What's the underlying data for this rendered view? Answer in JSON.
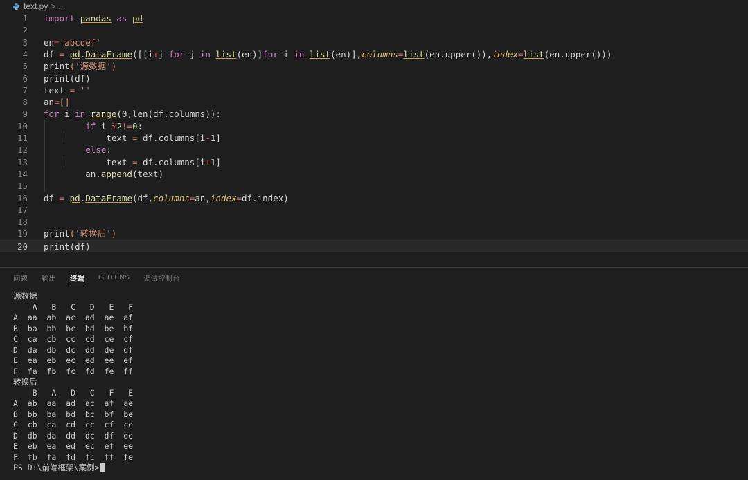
{
  "breadcrumb": {
    "file": "text.py",
    "separator": ">",
    "rest": "..."
  },
  "code_lines": [
    {
      "n": "1",
      "parts": [
        [
          "import",
          "kw"
        ],
        [
          " ",
          ""
        ],
        [
          "pandas",
          "mod"
        ],
        [
          " ",
          ""
        ],
        [
          "as",
          "kw"
        ],
        [
          " ",
          ""
        ],
        [
          "pd",
          "mod"
        ]
      ]
    },
    {
      "n": "2",
      "parts": []
    },
    {
      "n": "3",
      "parts": [
        [
          "en",
          "plain"
        ],
        [
          "=",
          "op"
        ],
        [
          "'abcdef'",
          "str"
        ]
      ]
    },
    {
      "n": "4",
      "parts": [
        [
          "df",
          "plain"
        ],
        [
          " = ",
          "op"
        ],
        [
          "pd",
          "mod"
        ],
        [
          ".",
          "plain"
        ],
        [
          "DataFrame",
          "mod"
        ],
        [
          "([[",
          "plain"
        ],
        [
          "i",
          "plain"
        ],
        [
          "+",
          "op"
        ],
        [
          "j ",
          "plain"
        ],
        [
          "for",
          "kw"
        ],
        [
          " j ",
          "plain"
        ],
        [
          "in",
          "kw"
        ],
        [
          " ",
          ""
        ],
        [
          "list",
          "mod"
        ],
        [
          "(en)]",
          "plain"
        ],
        [
          "for",
          "kw"
        ],
        [
          " i ",
          "plain"
        ],
        [
          "in",
          "kw"
        ],
        [
          " ",
          ""
        ],
        [
          "list",
          "mod"
        ],
        [
          "(en)],",
          "plain"
        ],
        [
          "columns",
          "param"
        ],
        [
          "=",
          "op"
        ],
        [
          "list",
          "mod"
        ],
        [
          "(en.upper()),",
          "plain"
        ],
        [
          "index",
          "param"
        ],
        [
          "=",
          "op"
        ],
        [
          "list",
          "mod"
        ],
        [
          "(en.upper()))",
          "plain"
        ]
      ]
    },
    {
      "n": "5",
      "parts": [
        [
          "print",
          "plain"
        ],
        [
          "('源数据')",
          "str"
        ]
      ]
    },
    {
      "n": "6",
      "parts": [
        [
          "print",
          "plain"
        ],
        [
          "(df)",
          "plain"
        ]
      ]
    },
    {
      "n": "7",
      "parts": [
        [
          "text",
          "plain"
        ],
        [
          " = ",
          "op"
        ],
        [
          "''",
          "str"
        ]
      ]
    },
    {
      "n": "8",
      "parts": [
        [
          "an",
          "plain"
        ],
        [
          "=",
          "op"
        ],
        [
          "[]",
          "str"
        ]
      ]
    },
    {
      "n": "9",
      "parts": [
        [
          "for",
          "kw"
        ],
        [
          " i ",
          "plain"
        ],
        [
          "in",
          "kw"
        ],
        [
          " ",
          ""
        ],
        [
          "range",
          "mod"
        ],
        [
          "(0,len(df.columns)):",
          "plain"
        ]
      ]
    },
    {
      "n": "10",
      "parts": [
        [
          "        ",
          ""
        ],
        [
          "if",
          "kw"
        ],
        [
          " i ",
          "plain"
        ],
        [
          "%",
          "op"
        ],
        [
          "2",
          "num"
        ],
        [
          "!=",
          "op"
        ],
        [
          "0",
          "num"
        ],
        [
          ":",
          "plain"
        ]
      ]
    },
    {
      "n": "11",
      "parts": [
        [
          "            text ",
          "plain"
        ],
        [
          "=",
          "op"
        ],
        [
          " df.columns[i",
          "plain"
        ],
        [
          "-",
          "op"
        ],
        [
          "1]",
          "plain"
        ]
      ]
    },
    {
      "n": "12",
      "parts": [
        [
          "        ",
          ""
        ],
        [
          "else",
          "kw"
        ],
        [
          ":",
          "plain"
        ]
      ]
    },
    {
      "n": "13",
      "parts": [
        [
          "            text ",
          "plain"
        ],
        [
          "=",
          "op"
        ],
        [
          " df.columns[i",
          "plain"
        ],
        [
          "+",
          "op"
        ],
        [
          "1]",
          "plain"
        ]
      ]
    },
    {
      "n": "14",
      "parts": [
        [
          "        an.",
          "plain"
        ],
        [
          "append",
          "mod"
        ],
        [
          "(text)",
          "plain"
        ]
      ]
    },
    {
      "n": "15",
      "parts": []
    },
    {
      "n": "16",
      "parts": [
        [
          "df",
          "plain"
        ],
        [
          " = ",
          "op"
        ],
        [
          "pd",
          "mod"
        ],
        [
          ".",
          "plain"
        ],
        [
          "DataFrame",
          "mod"
        ],
        [
          "(df,",
          "plain"
        ],
        [
          "columns",
          "param"
        ],
        [
          "=",
          "op"
        ],
        [
          "an,",
          "plain"
        ],
        [
          "index",
          "param"
        ],
        [
          "=",
          "op"
        ],
        [
          "df.index)",
          "plain"
        ]
      ]
    },
    {
      "n": "17",
      "parts": []
    },
    {
      "n": "18",
      "parts": []
    },
    {
      "n": "19",
      "parts": [
        [
          "print",
          "plain"
        ],
        [
          "('转换后')",
          "str"
        ]
      ]
    },
    {
      "n": "20",
      "parts": [
        [
          "print",
          "plain"
        ],
        [
          "(df)",
          "plain"
        ]
      ]
    }
  ],
  "panel_tabs": [
    "问题",
    "输出",
    "终端",
    "GITLENS",
    "调试控制台"
  ],
  "active_tab": "终端",
  "terminal_lines": [
    "源数据",
    "    A   B   C   D   E   F",
    "A  aa  ab  ac  ad  ae  af",
    "B  ba  bb  bc  bd  be  bf",
    "C  ca  cb  cc  cd  ce  cf",
    "D  da  db  dc  dd  de  df",
    "E  ea  eb  ec  ed  ee  ef",
    "F  fa  fb  fc  fd  fe  ff",
    "转换后",
    "    B   A   D   C   F   E",
    "A  ab  aa  ad  ac  af  ae",
    "B  bb  ba  bd  bc  bf  be",
    "C  cb  ca  cd  cc  cf  ce",
    "D  db  da  dd  dc  df  de",
    "E  eb  ea  ed  ec  ef  ee",
    "F  fb  fa  fd  fc  ff  fe"
  ],
  "prompt": "PS D:\\前端框架\\案例>",
  "colors": {
    "kw": "#c586c0",
    "mod": "#dcdcaa",
    "str": "#ce9178",
    "op": "#d16969",
    "num": "#b5cea8",
    "param": "#e5c07b",
    "plain": "#d4d4d4"
  }
}
